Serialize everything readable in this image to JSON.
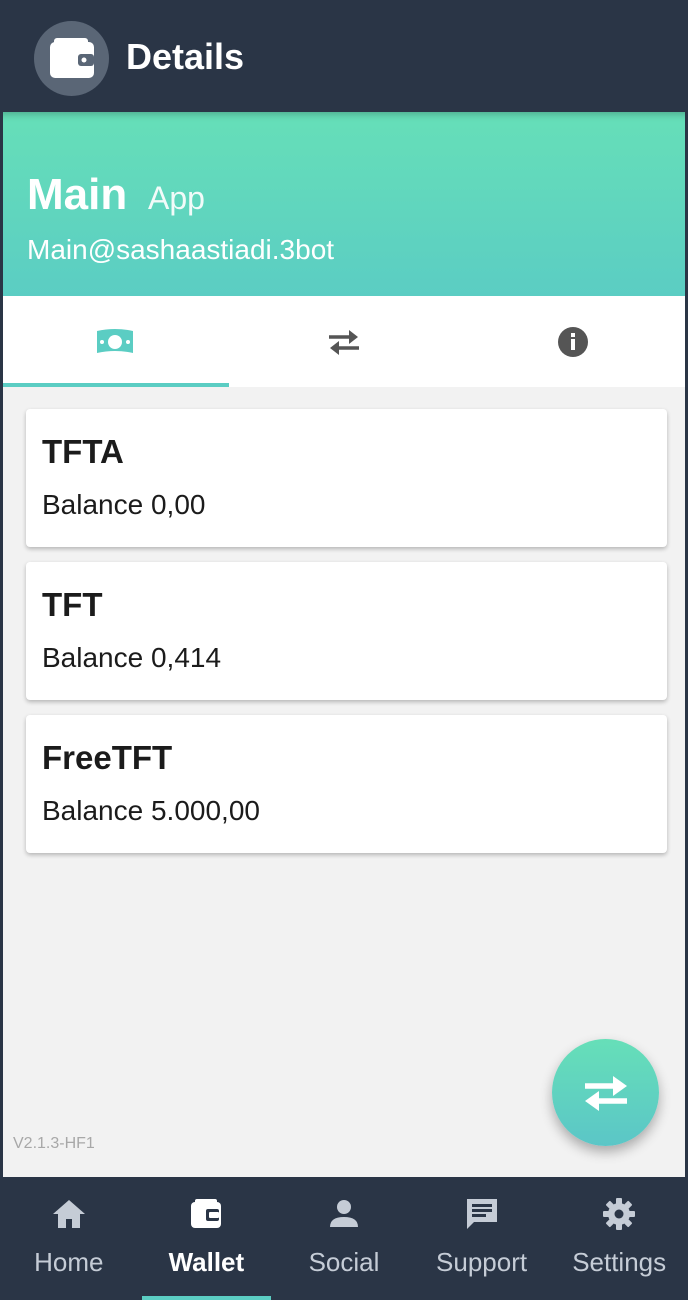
{
  "appbar": {
    "title": "Details",
    "icon": "wallet-icon"
  },
  "wallet": {
    "name": "Main",
    "type": "App",
    "address": "Main@sashaastiadi.3bot"
  },
  "tabs": [
    {
      "icon": "money-icon",
      "active": true
    },
    {
      "icon": "swap-icon",
      "active": false
    },
    {
      "icon": "info-icon",
      "active": false
    }
  ],
  "balances": [
    {
      "currency": "TFTA",
      "balance": "Balance 0,00"
    },
    {
      "currency": "TFT",
      "balance": "Balance 0,414"
    },
    {
      "currency": "FreeTFT",
      "balance": "Balance 5.000,00"
    }
  ],
  "fab": {
    "icon": "swap-icon"
  },
  "version": "V2.1.3-HF1",
  "nav": [
    {
      "label": "Home",
      "icon": "home-icon",
      "active": false
    },
    {
      "label": "Wallet",
      "icon": "wallet-icon",
      "active": true
    },
    {
      "label": "Social",
      "icon": "person-icon",
      "active": false
    },
    {
      "label": "Support",
      "icon": "chat-icon",
      "active": false
    },
    {
      "label": "Settings",
      "icon": "gear-icon",
      "active": false
    }
  ],
  "colors": {
    "dark": "#2a3546",
    "accent": "#5bcdc3",
    "accent_light": "#66dfb8",
    "background": "#f2f2f2"
  }
}
